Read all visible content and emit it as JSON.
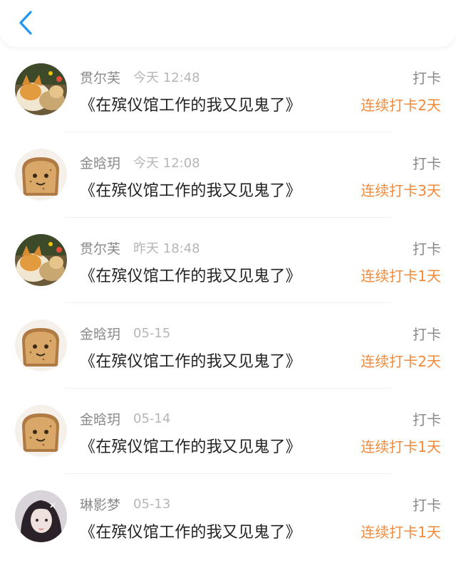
{
  "header": {
    "back_icon": "chevron-left-icon",
    "accent": "#2196f3"
  },
  "colors": {
    "streak": "#f08a3a",
    "name": "#8a8a8a",
    "time": "#b6b6b6",
    "title": "#222222"
  },
  "items": [
    {
      "avatar": "cat-avatar",
      "name": "贯尔芙",
      "time": "今天 12:48",
      "title": "《在殡仪馆工作的我又见鬼了》",
      "action": "打卡",
      "streak": "连续打卡2天"
    },
    {
      "avatar": "toast-avatar",
      "name": "金晗玥",
      "time": "今天 12:08",
      "title": "《在殡仪馆工作的我又见鬼了》",
      "action": "打卡",
      "streak": "连续打卡3天"
    },
    {
      "avatar": "cat-avatar",
      "name": "贯尔芙",
      "time": "昨天 18:48",
      "title": "《在殡仪馆工作的我又见鬼了》",
      "action": "打卡",
      "streak": "连续打卡1天"
    },
    {
      "avatar": "toast-avatar",
      "name": "金晗玥",
      "time": "05-15",
      "title": "《在殡仪馆工作的我又见鬼了》",
      "action": "打卡",
      "streak": "连续打卡2天"
    },
    {
      "avatar": "toast-avatar",
      "name": "金晗玥",
      "time": "05-14",
      "title": "《在殡仪馆工作的我又见鬼了》",
      "action": "打卡",
      "streak": "连续打卡1天"
    },
    {
      "avatar": "girl-avatar",
      "name": "琳影梦",
      "time": "05-13",
      "title": "《在殡仪馆工作的我又见鬼了》",
      "action": "打卡",
      "streak": "连续打卡1天"
    }
  ]
}
